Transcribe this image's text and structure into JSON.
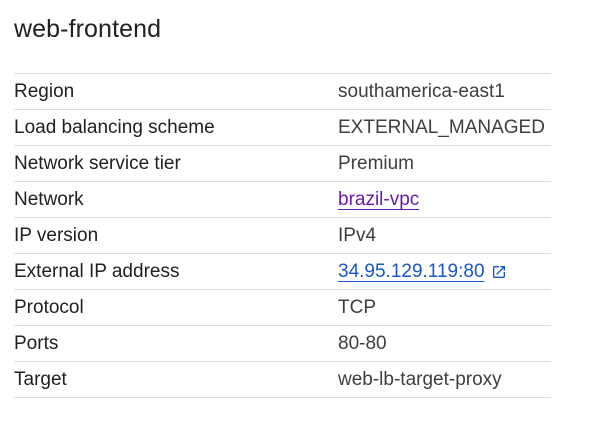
{
  "panel": {
    "title": "web-frontend"
  },
  "details": {
    "region": {
      "label": "Region",
      "value": "southamerica-east1"
    },
    "lb_scheme": {
      "label": "Load balancing scheme",
      "value": "EXTERNAL_MANAGED"
    },
    "network_tier": {
      "label": "Network service tier",
      "value": "Premium"
    },
    "network": {
      "label": "Network",
      "value": "brazil-vpc"
    },
    "ip_version": {
      "label": "IP version",
      "value": "IPv4"
    },
    "external_ip": {
      "label": "External IP address",
      "value": "34.95.129.119:80"
    },
    "protocol": {
      "label": "Protocol",
      "value": "TCP"
    },
    "ports": {
      "label": "Ports",
      "value": "80-80"
    },
    "target": {
      "label": "Target",
      "value": "web-lb-target-proxy"
    }
  },
  "icons": {
    "external_link": "open-in-new-icon"
  },
  "colors": {
    "visited_link": "#681da8",
    "link": "#1a57c4",
    "divider": "#dadce0"
  }
}
